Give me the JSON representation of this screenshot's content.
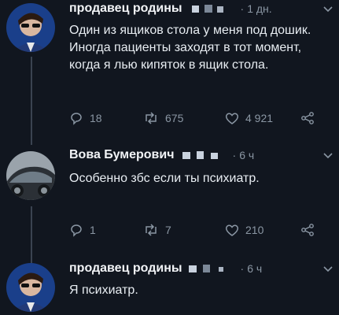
{
  "tweets": [
    {
      "author": "продавец родины",
      "time": "1 дн.",
      "text": "Один из ящиков стола у меня под дошик. Иногда пациенты заходят в тот момент, когда я лью кипяток в ящик стола.",
      "replies": "18",
      "retweets": "675",
      "likes": "4 921"
    },
    {
      "author": "Вова Бумерович",
      "time": "6 ч",
      "text": "Особенно збс если ты психиатр.",
      "replies": "1",
      "retweets": "7",
      "likes": "210"
    },
    {
      "author": "продавец родины",
      "time": "6 ч",
      "text": "Я психиатр."
    }
  ],
  "colors": {
    "background": "#11161f",
    "muted": "#8a96a3",
    "text": "#e8edf2"
  },
  "icons": [
    "reply-icon",
    "retweet-icon",
    "like-icon",
    "share-icon",
    "chevron-down-icon"
  ]
}
